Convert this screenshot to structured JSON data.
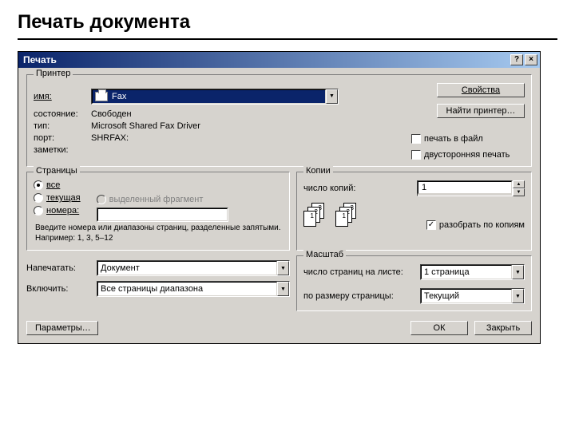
{
  "slide": {
    "title": "Печать документа"
  },
  "window": {
    "title": "Печать"
  },
  "printer": {
    "legend": "Принтер",
    "name_label": "имя:",
    "name_value": "Fax",
    "state_label": "состояние:",
    "state_value": "Свободен",
    "type_label": "тип:",
    "type_value": "Microsoft Shared Fax Driver",
    "port_label": "порт:",
    "port_value": "SHRFAX:",
    "notes_label": "заметки:",
    "btn_props": "Свойства",
    "btn_find": "Найти принтер…",
    "chk_tofile": "печать в файл",
    "chk_duplex": "двусторонняя печать"
  },
  "pages": {
    "legend": "Страницы",
    "opt_all": "все",
    "opt_current": "текущая",
    "opt_selection": "выделенный фрагмент",
    "opt_numbers": "номера:",
    "hint": "Введите номера или диапазоны страниц, разделенные запятыми. Например: 1, 3, 5–12"
  },
  "copies": {
    "legend": "Копии",
    "count_label": "число копий:",
    "count_value": "1",
    "collate_label": "разобрать по копиям"
  },
  "lower": {
    "print_label": "Напечатать:",
    "print_value": "Документ",
    "include_label": "Включить:",
    "include_value": "Все страницы диапазона"
  },
  "scale": {
    "legend": "Масштаб",
    "persheet_label": "число страниц на листе:",
    "persheet_value": "1 страница",
    "fit_label": "по размеру страницы:",
    "fit_value": "Текущий"
  },
  "footer": {
    "options": "Параметры…",
    "ok": "ОК",
    "close": "Закрыть"
  }
}
